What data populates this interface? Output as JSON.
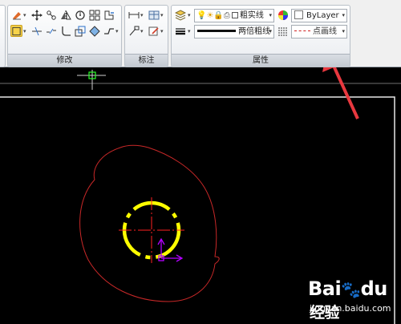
{
  "ribbon": {
    "modify_panel_title": "修改",
    "annotate_panel_title": "标注",
    "properties_panel_title": "属性",
    "layer_combo_value": "粗实线",
    "color_combo_value": "ByLayer",
    "lineweight_combo_value": "两倍粗线",
    "linetype_combo_value": "点画线"
  },
  "colors": {
    "arrow": "#e8383f",
    "circle_yellow": "#ffff00",
    "center_red": "#ff2020",
    "freehand_red": "#c82828",
    "ucs_magenta": "#b400ff",
    "crosshair_green": "#2aff2a"
  },
  "watermark": {
    "logo_text": "Bai",
    "logo_suffix": "du",
    "brand": "经验",
    "url": "jingyan.baidu.com"
  }
}
